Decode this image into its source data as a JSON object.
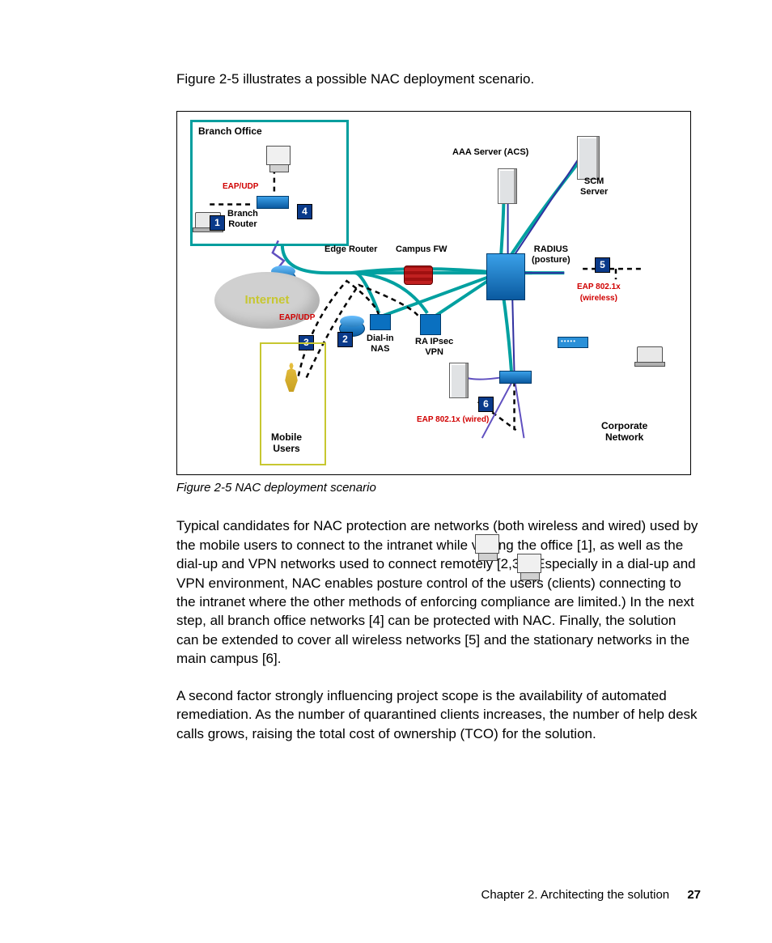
{
  "intro": "Figure 2-5 illustrates a possible NAC deployment scenario.",
  "caption": "Figure 2-5   NAC deployment scenario",
  "para1": "Typical candidates for NAC protection are networks (both wireless and wired) used by the mobile users to connect to the intranet while visiting the office [1], as well as the dial-up and VPN networks used to connect remotely [2,3]. (Especially in a dial-up and VPN environment, NAC enables posture control of the users (clients) connecting to the intranet where the other methods of enforcing compliance are limited.) In the next step, all branch office networks [4] can be protected with NAC. Finally, the solution can be extended to cover all wireless networks [5] and the stationary networks in the main campus [6].",
  "para2": "A second factor strongly influencing project scope is the availability of automated remediation. As the number of quarantined clients increases, the number of help desk calls grows, raising the total cost of ownership (TCO) for the solution.",
  "footer": {
    "chapter": "Chapter 2. Architecting the solution",
    "page": "27"
  },
  "diagram": {
    "branch_office": "Branch Office",
    "branch_router": "Branch\nRouter",
    "eap_udp": "EAP/UDP",
    "internet": "Internet",
    "mobile_users": "Mobile\nUsers",
    "edge_router": "Edge Router",
    "campus_fw": "Campus FW",
    "dial_in_nas": "Dial-in\nNAS",
    "ra_ipsec_vpn": "RA IPsec\nVPN",
    "aaa_server": "AAA Server (ACS)",
    "scm_server": "SCM\nServer",
    "radius_posture": "RADIUS\n(posture)",
    "eap_802_wireless": "EAP 802.1x\n(wireless)",
    "eap_802_wired": "EAP 802.1x (wired)",
    "corporate_network": "Corporate\nNetwork",
    "numbers": {
      "n1": "1",
      "n2": "2",
      "n3": "3",
      "n4": "4",
      "n5": "5",
      "n6": "6"
    }
  }
}
